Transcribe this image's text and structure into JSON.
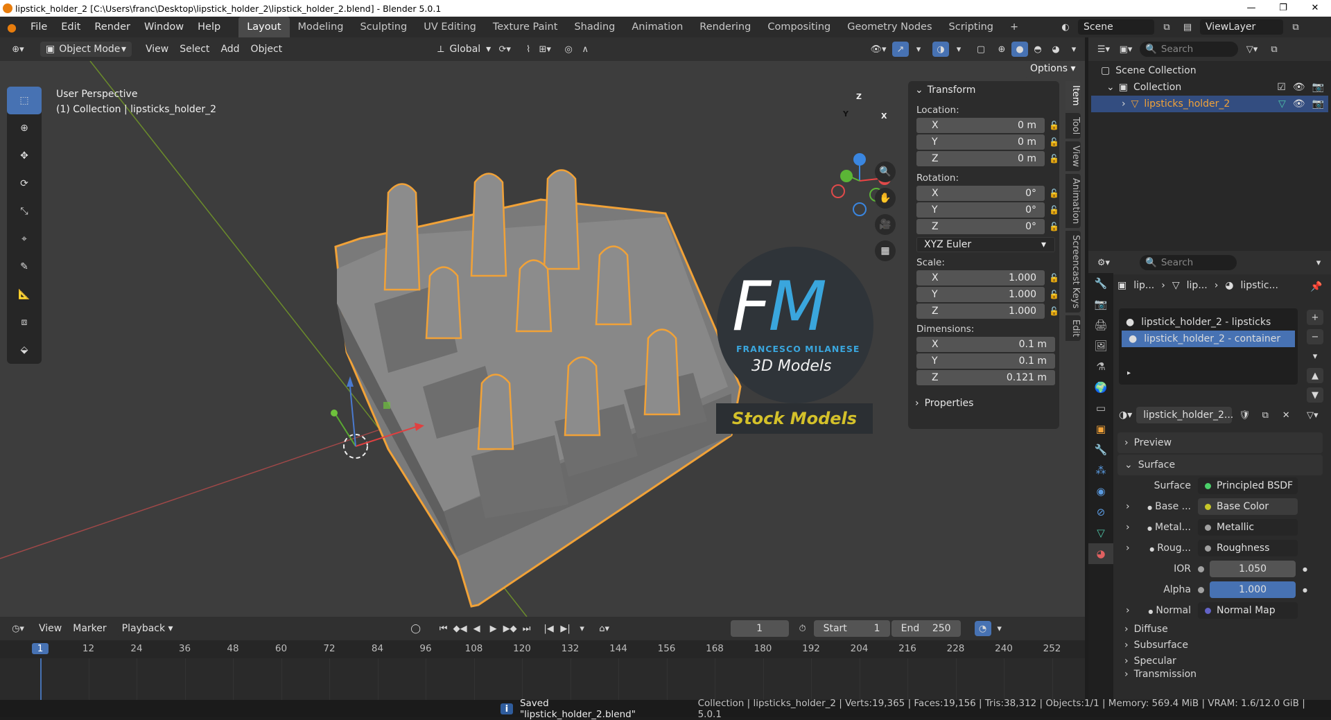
{
  "window": {
    "title": "lipstick_holder_2 [C:\\Users\\franc\\Desktop\\lipstick_holder_2\\lipstick_holder_2.blend] - Blender 5.0.1",
    "controls": [
      "—",
      "❐",
      "✕"
    ]
  },
  "menubar": {
    "menus": [
      "File",
      "Edit",
      "Render",
      "Window",
      "Help"
    ],
    "workspaces": [
      "Layout",
      "Modeling",
      "Sculpting",
      "UV Editing",
      "Texture Paint",
      "Shading",
      "Animation",
      "Rendering",
      "Compositing",
      "Geometry Nodes",
      "Scripting"
    ],
    "active_workspace": "Layout",
    "add_tab": "+",
    "scene_name": "Scene",
    "view_layer": "ViewLayer"
  },
  "viewport_header": {
    "mode": "Object Mode",
    "menus": [
      "View",
      "Select",
      "Add",
      "Object"
    ],
    "orientation": "Global",
    "options": "Options"
  },
  "viewport": {
    "perspective": "User Perspective",
    "collection_info": "(1) Collection | lipsticks_holder_2",
    "gizmo_axes": [
      "X",
      "Y",
      "Z"
    ],
    "watermark": {
      "logo_letters": "FM",
      "company": "FRANCESCO MILANESE",
      "subtitle": "3D Models",
      "banner": "Stock Models"
    }
  },
  "npanel": {
    "section": "Transform",
    "location_label": "Location:",
    "location": [
      {
        "axis": "X",
        "value": "0 m"
      },
      {
        "axis": "Y",
        "value": "0 m"
      },
      {
        "axis": "Z",
        "value": "0 m"
      }
    ],
    "rotation_label": "Rotation:",
    "rotation": [
      {
        "axis": "X",
        "value": "0°"
      },
      {
        "axis": "Y",
        "value": "0°"
      },
      {
        "axis": "Z",
        "value": "0°"
      }
    ],
    "rotation_mode": "XYZ Euler",
    "scale_label": "Scale:",
    "scale": [
      {
        "axis": "X",
        "value": "1.000"
      },
      {
        "axis": "Y",
        "value": "1.000"
      },
      {
        "axis": "Z",
        "value": "1.000"
      }
    ],
    "dimensions_label": "Dimensions:",
    "dimensions": [
      {
        "axis": "X",
        "value": "0.1 m"
      },
      {
        "axis": "Y",
        "value": "0.1 m"
      },
      {
        "axis": "Z",
        "value": "0.121 m"
      }
    ],
    "properties_section": "Properties",
    "tabs": [
      "Item",
      "Tool",
      "View",
      "Animation",
      "Screencast Keys",
      "Edit"
    ],
    "active_tab": "Item"
  },
  "outliner": {
    "search_placeholder": "Search",
    "scene_collection": "Scene Collection",
    "collection": "Collection",
    "object": "lipsticks_holder_2"
  },
  "properties": {
    "search_placeholder": "Search",
    "breadcrumb": [
      "lip...",
      "lip...",
      "lipstic..."
    ],
    "materials": [
      "lipstick_holder_2 - lipsticks",
      "lipstick_holder_2 - container"
    ],
    "active_material": "lipstick_holder_2 - container",
    "material_name": "lipstick_holder_2...",
    "panels": {
      "preview": "Preview",
      "surface": "Surface",
      "surface_label": "Surface",
      "surface_shader": "Principled BSDF",
      "inputs": [
        {
          "label": "Base ...",
          "value": "Base Color",
          "socket_color": "#c7c729",
          "expandable": true,
          "highlight": true
        },
        {
          "label": "Metal...",
          "value": "Metallic",
          "socket_color": "#a1a1a1",
          "expandable": true
        },
        {
          "label": "Roug...",
          "value": "Roughness",
          "socket_color": "#a1a1a1",
          "expandable": true
        }
      ],
      "ior_label": "IOR",
      "ior_value": "1.050",
      "alpha_label": "Alpha",
      "alpha_value": "1.000",
      "normal_label": "Normal",
      "normal_value": "Normal Map",
      "subsections": [
        "Diffuse",
        "Subsurface",
        "Specular",
        "Transmission"
      ]
    }
  },
  "timeline": {
    "menus": [
      "View",
      "Marker",
      "Playback"
    ],
    "current_frame": "1",
    "start_label": "Start",
    "start": "1",
    "end_label": "End",
    "end": "250",
    "ticks": [
      "1",
      "12",
      "24",
      "36",
      "48",
      "60",
      "72",
      "84",
      "96",
      "108",
      "120",
      "132",
      "144",
      "156",
      "168",
      "180",
      "192",
      "204",
      "216",
      "228",
      "240",
      "252"
    ]
  },
  "statusbar": {
    "message": "Saved \"lipstick_holder_2.blend\"",
    "stats": "Collection | lipsticks_holder_2 | Verts:19,365 | Faces:19,156 | Tris:38,312 | Objects:1/1 | Memory: 569.4 MiB | VRAM: 1.6/12.0 GiB | 5.0.1"
  },
  "colors": {
    "accent": "#4772b3",
    "selection_outline": "#f1a238",
    "watermark_banner_text": "#d4c12a",
    "watermark_blue": "#3aa6dd"
  }
}
